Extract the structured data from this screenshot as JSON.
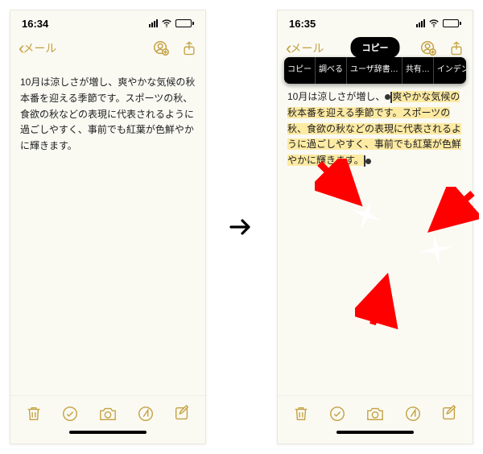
{
  "left": {
    "status_time": "16:34",
    "nav_back": "メール",
    "note_text": "10月は涼しさが増し、爽やかな気候の秋本番を迎える季節です。スポーツの秋、食欲の秋などの表現に代表されるように過ごしやすく、事前でも紅葉が色鮮やかに輝きます。"
  },
  "right": {
    "status_time": "16:35",
    "nav_back": "メール",
    "pill_label": "コピー",
    "context_menu": {
      "item0": "コピー",
      "item1": "調べる",
      "item2": "ユーザ辞書…",
      "item3": "共有…",
      "item4": "インデント"
    },
    "note_line1_plain": "10月は涼しさが増し、",
    "note_line1_hi": "爽やかな気候の秋本番を迎える季節です。",
    "note_line_hi": "スポーツの秋、食欲の秋などの表現に代表されるように過ごしやすく、事前でも紅葉が色鮮やかに輝きます。"
  }
}
